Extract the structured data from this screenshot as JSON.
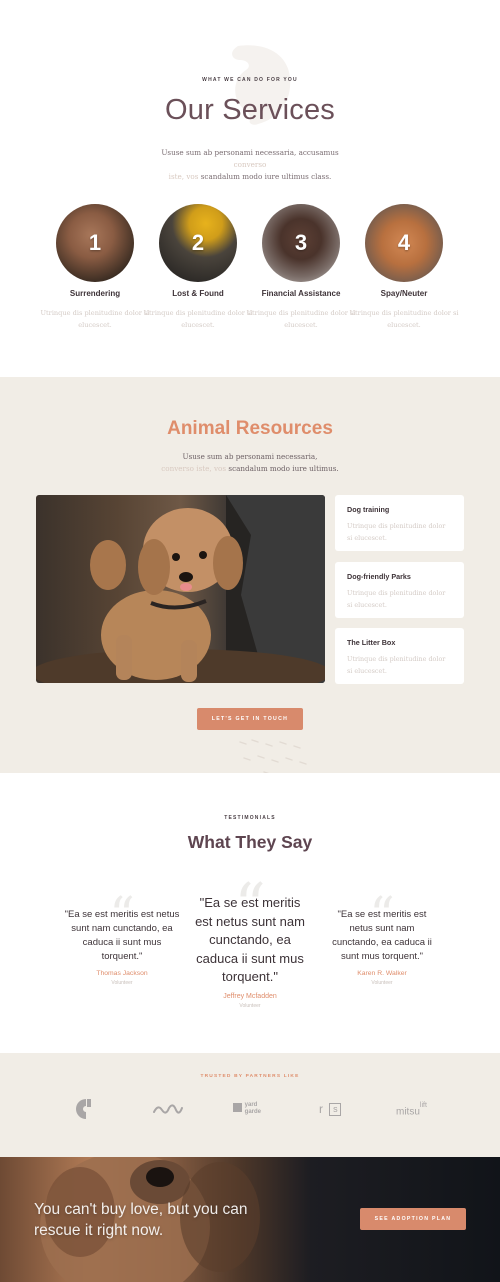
{
  "services": {
    "eyebrow": "WHAT WE CAN DO FOR YOU",
    "title": "Our Services",
    "description_main_1": "Ususe sum ab personami necessaria, accusamus",
    "description_faded_1": "converso",
    "description_faded_2": "iste, vos",
    "description_main_2": "scandalum modo iure ultimus class.",
    "items": [
      {
        "number": "1",
        "name": "Surrendering",
        "text": "Utrinque dis plenitudine dolor si elucescet."
      },
      {
        "number": "2",
        "name": "Lost & Found",
        "text": "Utrinque dis plenitudine dolor si elucescet."
      },
      {
        "number": "3",
        "name": "Financial Assistance",
        "text": "Utrinque dis plenitudine dolor si elucescet."
      },
      {
        "number": "4",
        "name": "Spay/Neuter",
        "text": "Utrinque dis plenitudine dolor si elucescet."
      }
    ]
  },
  "resources": {
    "title": "Animal Resources",
    "description_main_1": "Ususe sum ab personami necessaria,",
    "description_faded": "converso iste, vos",
    "description_main_2": "scandalum modo iure ultimus.",
    "cards": [
      {
        "title": "Dog training",
        "text": "Utrinque dis plenitudine dolor si elucescet."
      },
      {
        "title": "Dog-friendly Parks",
        "text": "Utrinque dis plenitudine dolor si elucescet."
      },
      {
        "title": "The Litter Box",
        "text": "Utrinque dis plenitudine dolor si elucescet."
      }
    ],
    "cta_label": "LET'S GET IN TOUCH"
  },
  "testimonials": {
    "eyebrow": "TESTIMONIALS",
    "title": "What They Say",
    "quote_mark": "“",
    "quotes": [
      {
        "text": "\"Ea se est meritis est netus sunt nam cunctando, ea caduca ii sunt mus torquent.\"",
        "name": "Thomas Jackson",
        "role": "Volunteer"
      },
      {
        "text": "\"Ea se est meritis est netus sunt nam cunctando, ea caduca ii sunt mus torquent.\"",
        "name": "Jeffrey Mcfadden",
        "role": "Volunteer"
      },
      {
        "text": "\"Ea se est meritis est netus sunt nam cunctando, ea caduca ii sunt mus torquent.\"",
        "name": "Karen R. Walker",
        "role": "Volunteer"
      }
    ]
  },
  "partners": {
    "eyebrow": "TRUSTED BY PARTNERS LIKE",
    "logos": [
      {
        "icon": "c-logo-icon"
      },
      {
        "icon": "wave-logo-icon"
      },
      {
        "icon": "yard-logo-icon",
        "line1": "yard",
        "line2": "garde"
      },
      {
        "icon": "rs-logo-icon",
        "text_r": "r",
        "text_s": "s"
      },
      {
        "icon": "mitsulift-logo-icon",
        "text_main": "mitsu",
        "text_super": "lift"
      }
    ]
  },
  "footer": {
    "headline": "You can't buy love, but you can rescue it right now.",
    "button_label": "SEE ADOPTION PLAN"
  },
  "colors": {
    "accent": "#d88a6c",
    "accent_text": "#df8d6b",
    "heading": "#6b5059",
    "beige_bg": "#f1ede6"
  }
}
